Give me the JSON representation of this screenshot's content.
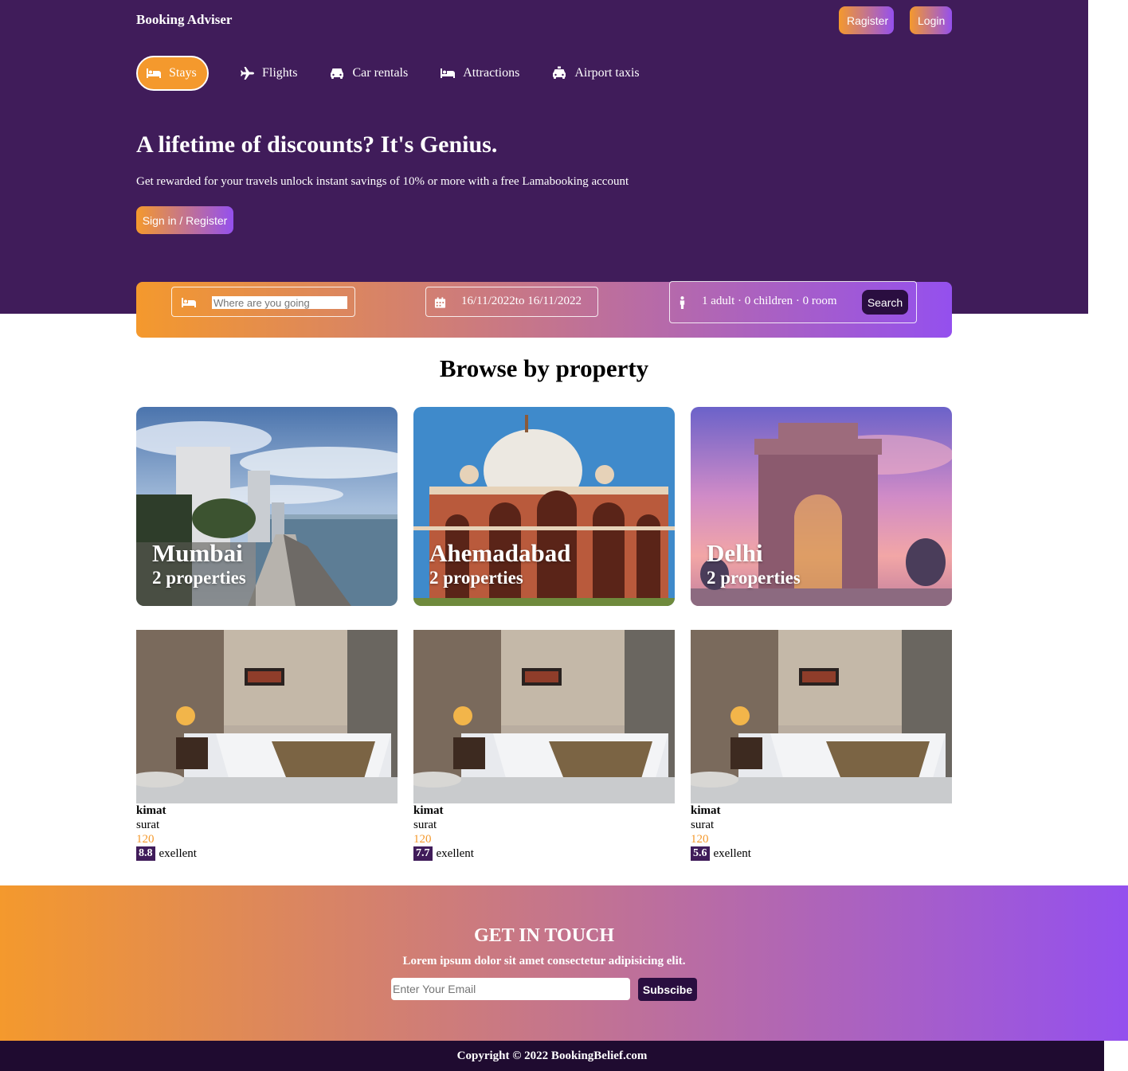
{
  "brand": "Booking Adviser",
  "header_buttons": {
    "register": "Ragister",
    "login": "Login"
  },
  "tabs": [
    {
      "label": "Stays",
      "icon": "bed-icon",
      "active": true
    },
    {
      "label": "Flights",
      "icon": "plane-icon"
    },
    {
      "label": "Car rentals",
      "icon": "car-icon"
    },
    {
      "label": "Attractions",
      "icon": "bed-icon"
    },
    {
      "label": "Airport taxis",
      "icon": "taxi-icon"
    }
  ],
  "hero": {
    "title": "A lifetime of discounts? It's Genius.",
    "subtitle": "Get rewarded for your travels unlock instant savings of 10% or more with a free Lamabooking account",
    "button": "Sign in / Register"
  },
  "search": {
    "destination_placeholder": "Where are you going",
    "date_range": "16/11/2022to 16/11/2022",
    "options": "1 adult · 0 children · 0 room",
    "button": "Search"
  },
  "browse": {
    "title": "Browse by property",
    "cities": [
      {
        "name": "Mumbai",
        "count": "2 properties"
      },
      {
        "name": "Ahemadabad",
        "count": "2 properties"
      },
      {
        "name": "Delhi",
        "count": "2 properties"
      }
    ]
  },
  "hotels": [
    {
      "name": "kimat",
      "city": "surat",
      "price": "120",
      "rating": "8.8",
      "rating_text": "exellent"
    },
    {
      "name": "kimat",
      "city": "surat",
      "price": "120",
      "rating": "7.7",
      "rating_text": "exellent"
    },
    {
      "name": "kimat",
      "city": "surat",
      "price": "120",
      "rating": "5.6",
      "rating_text": "exellent"
    }
  ],
  "contact": {
    "title": "GET IN TOUCH",
    "subtitle": "Lorem ipsum dolor sit amet consectetur adipisicing elit.",
    "email_placeholder": "Enter Your Email",
    "button": "Subscibe"
  },
  "copyright": "Copyright © 2022 BookingBelief.com",
  "colors": {
    "header": "#401c5a",
    "accent_orange": "#f4992d",
    "accent_purple": "#9450ee",
    "dark": "#2a0e40"
  }
}
